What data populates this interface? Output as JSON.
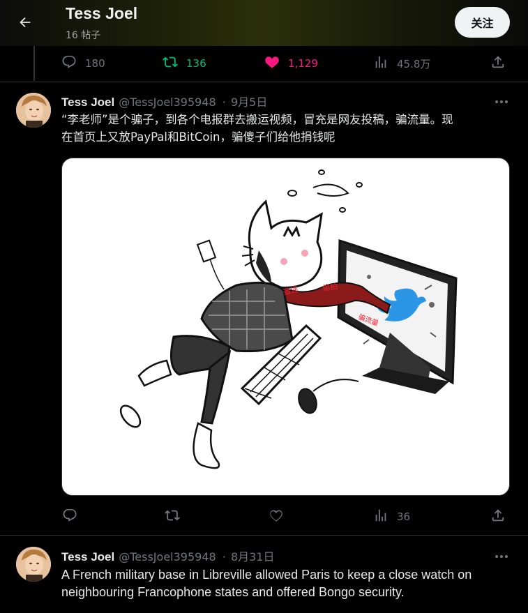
{
  "header": {
    "title": "Tess Joel",
    "subtitle": "16 帖子",
    "follow_label": "关注"
  },
  "prev_tweet_stats": {
    "replies": "180",
    "retweets": "136",
    "likes": "1,129",
    "views": "45.8万",
    "liked": true,
    "retweet_color": "#00ba7c",
    "like_color": "#f91880"
  },
  "tweets": [
    {
      "name": "Tess Joel",
      "handle": "@TessJoel395948",
      "sep": "·",
      "date": "9月5日",
      "text_line1": "“李老师”是个骗子，到各个电报群去搬运视频，冒充是网友投稿，骗流量。现",
      "text_line2": "在首页上又放PayPal和BitCoin，骗傻子们给他捐钱呢",
      "media_labels": [
        "偷拍",
        "造谣",
        "骗流量"
      ],
      "views": "36"
    },
    {
      "name": "Tess Joel",
      "handle": "@TessJoel395948",
      "sep": "·",
      "date": "8月31日",
      "text_line1": "A French military base in Libreville allowed Paris to keep a close watch on",
      "text_line2": "neighbouring Francophone states and offered Bongo security."
    }
  ],
  "icons": {
    "back": "back-arrow-icon",
    "reply": "reply-icon",
    "retweet": "retweet-icon",
    "like": "heart-icon",
    "views": "views-icon",
    "share": "share-icon",
    "more": "more-icon"
  }
}
